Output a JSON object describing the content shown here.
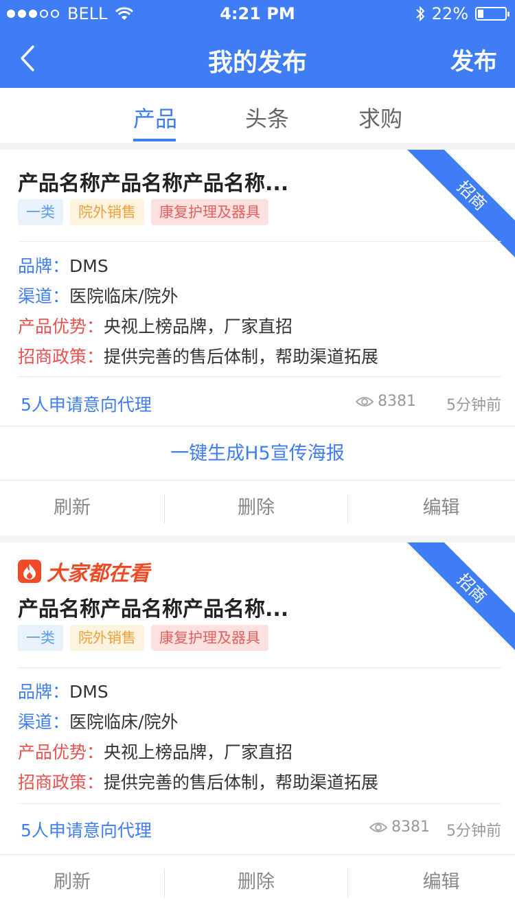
{
  "status": {
    "carrier": "BELL",
    "time": "4:21 PM",
    "battery": "22%",
    "battery_level": 0.22,
    "signal_bars": 3,
    "signal_total": 5
  },
  "header": {
    "title": "我的发布",
    "publish": "发布",
    "back_icon": "chevron-left-icon"
  },
  "tabs": [
    {
      "label": "产品",
      "active": true
    },
    {
      "label": "头条",
      "active": false
    },
    {
      "label": "求购",
      "active": false
    }
  ],
  "cards": [
    {
      "ribbon": "招商",
      "name": "产品名称产品名称产品名称...",
      "tags": [
        "一类",
        "院外销售",
        "康复护理及器具"
      ],
      "brand_label": "品牌：",
      "brand": "DMS",
      "channel_label": "渠道：",
      "channel": "医院临床/院外",
      "advantage_label": "产品优势：",
      "advantage": "央视上榜品牌，厂家直招",
      "policy_label": "招商政策：",
      "policy": "提供完善的售后体制，帮助渠道拓展",
      "applicants": "5人申请意向代理",
      "views": "8381",
      "time": "5分钟前",
      "poster": "一键生成H5宣传海报",
      "actions": [
        "刷新",
        "删除",
        "编辑"
      ]
    },
    {
      "hot": "大家都在看",
      "ribbon": "招商",
      "name": "产品名称产品名称产品名称...",
      "tags": [
        "一类",
        "院外销售",
        "康复护理及器具"
      ],
      "brand_label": "品牌：",
      "brand": "DMS",
      "channel_label": "渠道：",
      "channel": "医院临床/院外",
      "advantage_label": "产品优势：",
      "advantage": "央视上榜品牌，厂家直招",
      "policy_label": "招商政策：",
      "policy": "提供完善的售后体制，帮助渠道拓展",
      "applicants": "5人申请意向代理",
      "views": "8381",
      "time": "5分钟前",
      "actions": [
        "刷新",
        "删除",
        "编辑"
      ]
    }
  ],
  "colors": {
    "primary": "#3f7df4",
    "label_red": "#e9534f",
    "hot": "#ef4b27"
  }
}
